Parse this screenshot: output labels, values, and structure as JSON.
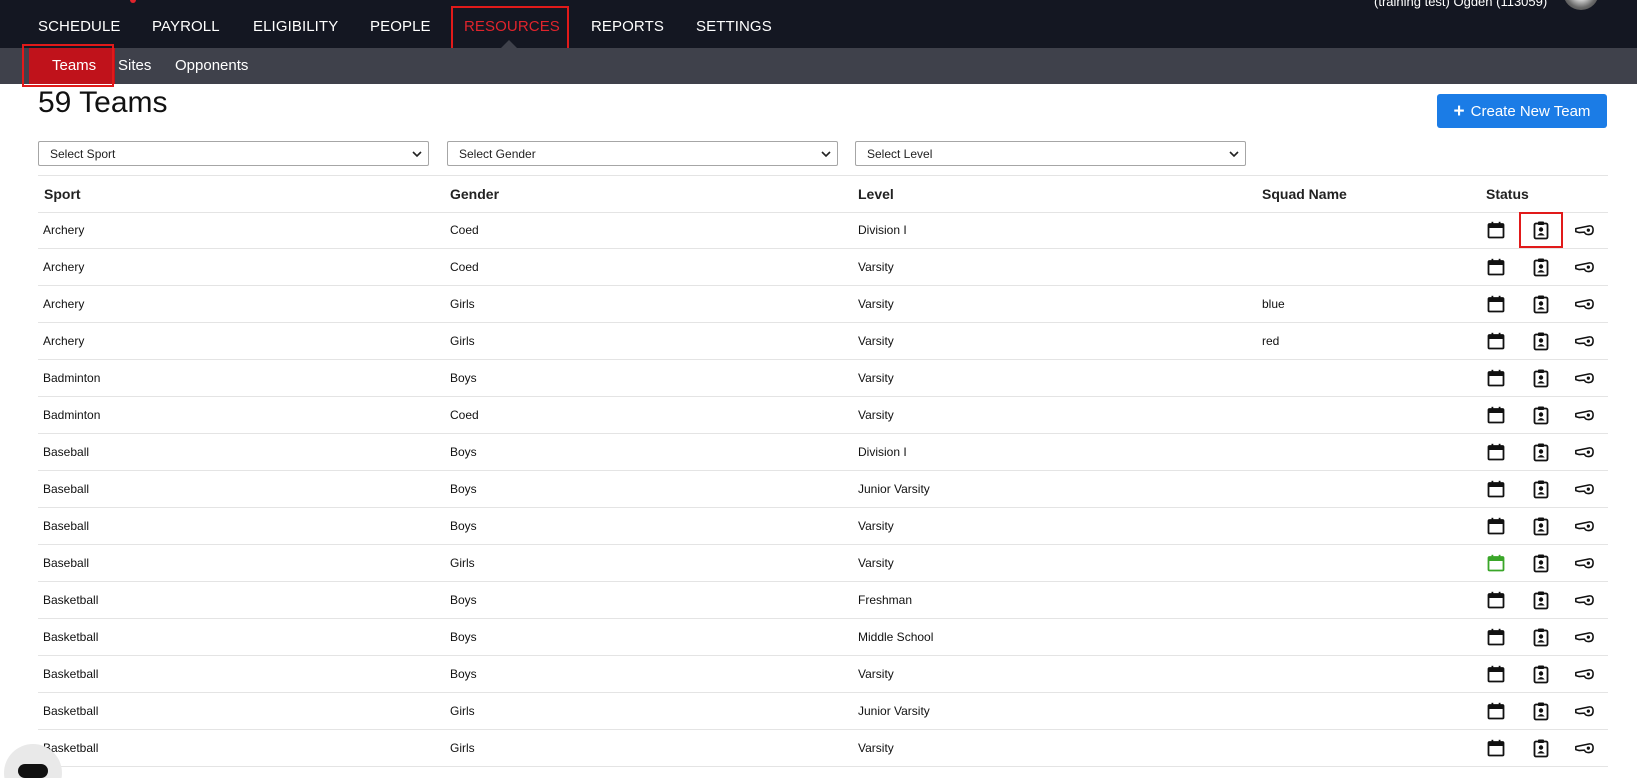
{
  "topnav": {
    "items": [
      {
        "label": "SCHEDULE"
      },
      {
        "label": "PAYROLL"
      },
      {
        "label": "ELIGIBILITY"
      },
      {
        "label": "PEOPLE"
      },
      {
        "label": "RESOURCES",
        "active": true
      },
      {
        "label": "REPORTS"
      },
      {
        "label": "SETTINGS"
      }
    ],
    "user_text": "(training test) Ogden (113059)"
  },
  "subnav": {
    "items": [
      {
        "label": "Teams",
        "active": true
      },
      {
        "label": "Sites"
      },
      {
        "label": "Opponents"
      }
    ]
  },
  "page": {
    "title": "59 Teams",
    "create_button": "Create New Team"
  },
  "filters": {
    "sport": "Select Sport",
    "gender": "Select Gender",
    "level": "Select Level"
  },
  "table": {
    "headers": {
      "sport": "Sport",
      "gender": "Gender",
      "level": "Level",
      "squad": "Squad Name",
      "status": "Status"
    },
    "rows": [
      {
        "sport": "Archery",
        "gender": "Coed",
        "level": "Division I",
        "squad": "",
        "schedule_active": false
      },
      {
        "sport": "Archery",
        "gender": "Coed",
        "level": "Varsity",
        "squad": "",
        "schedule_active": false
      },
      {
        "sport": "Archery",
        "gender": "Girls",
        "level": "Varsity",
        "squad": "blue",
        "schedule_active": false
      },
      {
        "sport": "Archery",
        "gender": "Girls",
        "level": "Varsity",
        "squad": "red",
        "schedule_active": false
      },
      {
        "sport": "Badminton",
        "gender": "Boys",
        "level": "Varsity",
        "squad": "",
        "schedule_active": false
      },
      {
        "sport": "Badminton",
        "gender": "Coed",
        "level": "Varsity",
        "squad": "",
        "schedule_active": false
      },
      {
        "sport": "Baseball",
        "gender": "Boys",
        "level": "Division I",
        "squad": "",
        "schedule_active": false
      },
      {
        "sport": "Baseball",
        "gender": "Boys",
        "level": "Junior Varsity",
        "squad": "",
        "schedule_active": false
      },
      {
        "sport": "Baseball",
        "gender": "Boys",
        "level": "Varsity",
        "squad": "",
        "schedule_active": false
      },
      {
        "sport": "Baseball",
        "gender": "Girls",
        "level": "Varsity",
        "squad": "",
        "schedule_active": true
      },
      {
        "sport": "Basketball",
        "gender": "Boys",
        "level": "Freshman",
        "squad": "",
        "schedule_active": false
      },
      {
        "sport": "Basketball",
        "gender": "Boys",
        "level": "Middle School",
        "squad": "",
        "schedule_active": false
      },
      {
        "sport": "Basketball",
        "gender": "Boys",
        "level": "Varsity",
        "squad": "",
        "schedule_active": false
      },
      {
        "sport": "Basketball",
        "gender": "Girls",
        "level": "Junior Varsity",
        "squad": "",
        "schedule_active": false
      },
      {
        "sport": "Basketball",
        "gender": "Girls",
        "level": "Varsity",
        "squad": "",
        "schedule_active": false
      }
    ]
  },
  "icons": {
    "schedule": "calendar-icon",
    "roster": "clipboard-person-icon",
    "officials": "whistle-icon"
  },
  "colors": {
    "nav_bg": "#141722",
    "subnav_bg": "#3f414b",
    "active_red": "#e0242c",
    "subnav_active_bg": "#c0121b",
    "button_blue": "#1b7ce6",
    "highlight_box": "#e11a1a",
    "schedule_active_green": "#3aa629"
  }
}
